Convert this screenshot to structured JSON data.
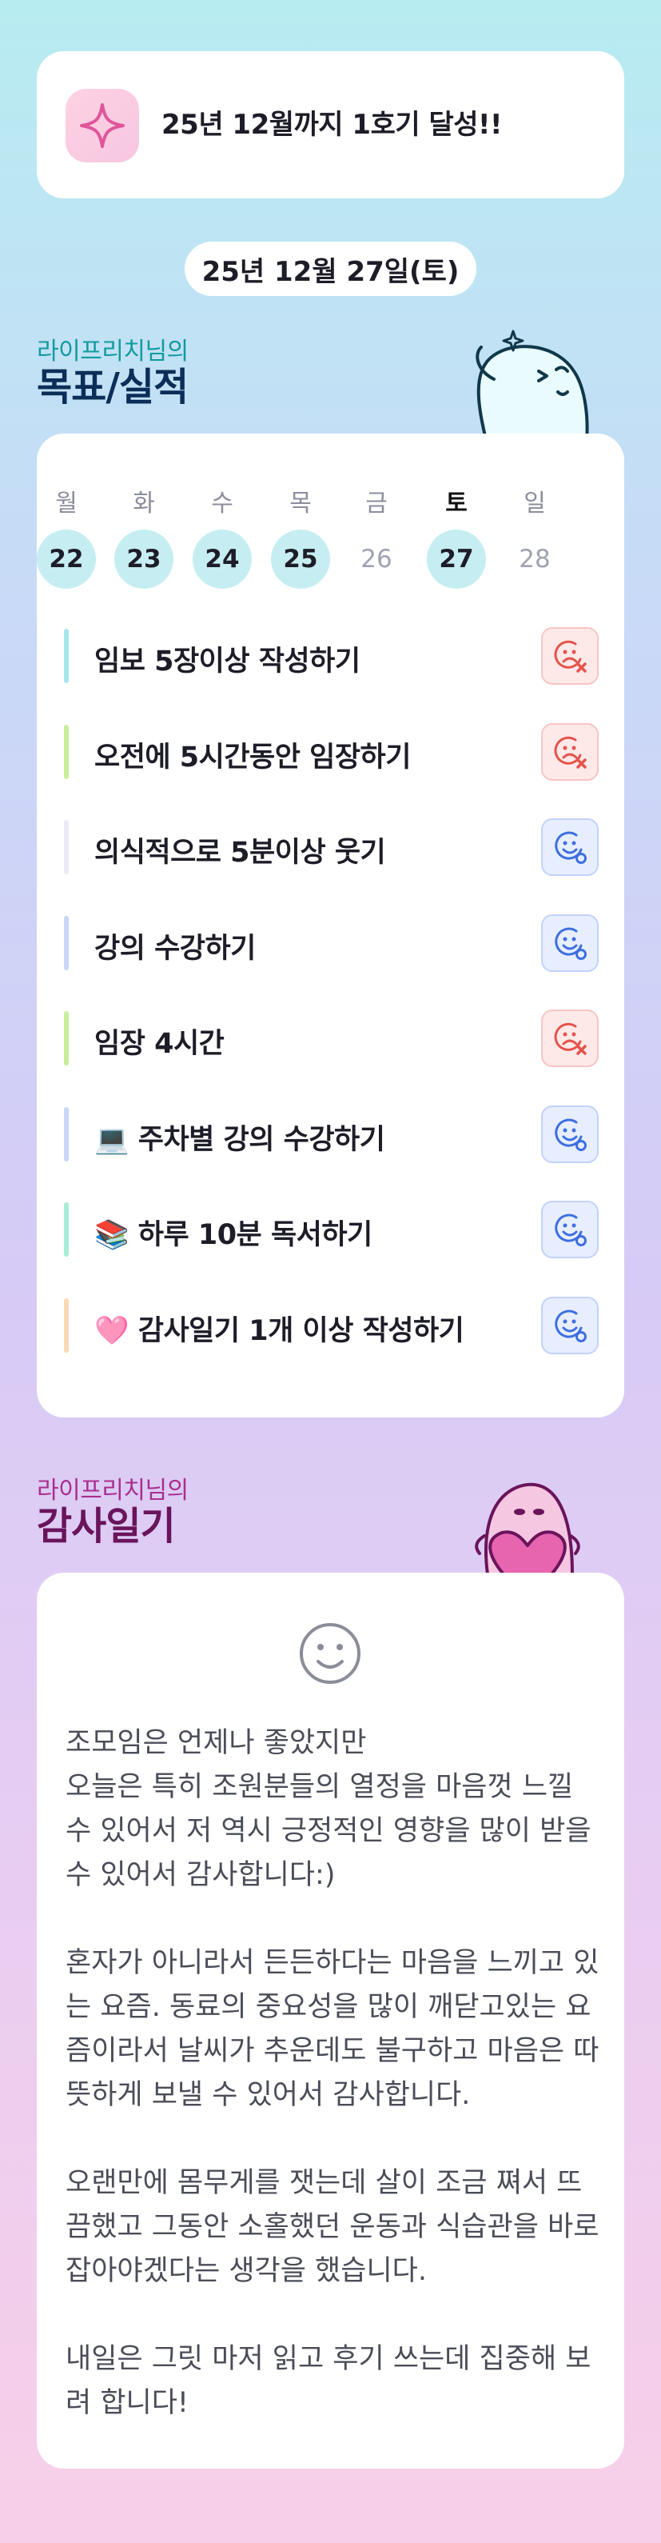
{
  "goal_banner": {
    "text": "25년 12월까지 1호기 달성!!",
    "icon": "sparkle-icon",
    "accent": "#e0559a"
  },
  "date": "25년 12월 27일(토)",
  "goals_section": {
    "subtitle": "라이프리치님의",
    "title": "목표/실적"
  },
  "week": {
    "days": [
      {
        "weekday": "월",
        "date": "22",
        "state": "done"
      },
      {
        "weekday": "화",
        "date": "23",
        "state": "done"
      },
      {
        "weekday": "수",
        "date": "24",
        "state": "done"
      },
      {
        "weekday": "목",
        "date": "25",
        "state": "done"
      },
      {
        "weekday": "금",
        "date": "26",
        "state": "off"
      },
      {
        "weekday": "토",
        "date": "27",
        "state": "today"
      },
      {
        "weekday": "일",
        "date": "28",
        "state": "off"
      }
    ]
  },
  "goals": [
    {
      "label": "임보 5장이상 작성하기",
      "result": "fail",
      "bar_color": "#a8e6ec"
    },
    {
      "label": "오전에 5시간동안 임장하기",
      "result": "fail",
      "bar_color": "#c8ee9a"
    },
    {
      "label": "의식적으로 5분이상 웃기",
      "result": "pass",
      "bar_color": "#eceaf2"
    },
    {
      "label": "강의 수강하기",
      "result": "pass",
      "bar_color": "#c9d6f8"
    },
    {
      "label": "임장 4시간",
      "result": "fail",
      "bar_color": "#c8ee9a"
    },
    {
      "label": "💻 주차별 강의 수강하기",
      "result": "pass",
      "bar_color": "#c9d6f8"
    },
    {
      "label": "📚 하루 10분 독서하기",
      "result": "pass",
      "bar_color": "#a8ecd8"
    },
    {
      "label": "🩷 감사일기 1개 이상 작성하기",
      "result": "pass",
      "bar_color": "#fbd9b6"
    }
  ],
  "gratitude_section": {
    "subtitle": "라이프리치님의",
    "title": "감사일기"
  },
  "gratitude": {
    "icon": "smiley-icon",
    "paragraphs": [
      "조모임은 언제나 좋았지만\n오늘은 특히 조원분들의 열정을 마음껏 느낄 수 있어서 저 역시 긍정적인 영향을 많이 받을 수 있어서 감사합니다:)",
      "혼자가 아니라서 든든하다는 마음을 느끼고 있는 요즘. 동료의 중요성을 많이 깨닫고있는 요즘이라서 날씨가 추운데도 불구하고 마음은 따뜻하게 보낼 수 있어서 감사합니다.",
      "오랜만에 몸무게를 잿는데 살이 조금 쪄서 뜨끔했고 그동안 소홀했던 운동과 식습관을 바로잡아야겠다는 생각을 했습니다.",
      "내일은 그릿 마저 읽고 후기 쓰는데 집중해 보려 합니다!"
    ]
  },
  "colors": {
    "fail": "#e5534b",
    "pass": "#3e6fe0",
    "done_circle": "#c6eef2"
  }
}
